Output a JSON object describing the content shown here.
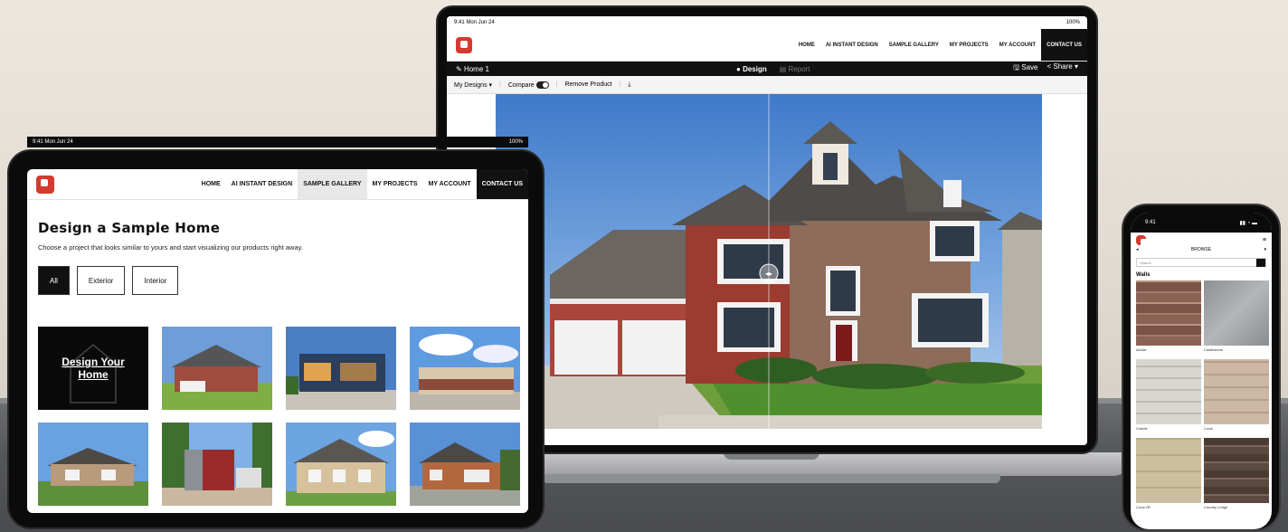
{
  "laptop": {
    "status_time": "9:41  Mon Jun 24",
    "status_right": "100%",
    "nav": [
      "HOME",
      "AI INSTANT DESIGN",
      "SAMPLE GALLERY",
      "MY PROJECTS",
      "MY ACCOUNT",
      "CONTACT US"
    ],
    "project_name": "Home 1",
    "tab_design": "Design",
    "tab_report": "Report",
    "save": "Save",
    "share": "Share",
    "tool_my_designs": "My Designs",
    "tool_compare": "Compare",
    "tool_remove": "Remove Product"
  },
  "tablet": {
    "status_time": "9:41  Mon Jun 24",
    "status_right": "100%",
    "nav": [
      "HOME",
      "AI INSTANT DESIGN",
      "SAMPLE GALLERY",
      "MY PROJECTS",
      "MY ACCOUNT",
      "CONTACT US"
    ],
    "title": "Design a Sample Home",
    "subtitle": "Choose a project that looks similar to yours and start visualizing our products right away.",
    "filters": [
      "All",
      "Exterior",
      "Interior"
    ],
    "design_tile": "Design Your Home"
  },
  "phone": {
    "status_time": "9:41",
    "browse": "BROWSE",
    "search_placeholder": "Search",
    "section": "Walls",
    "tiles": [
      "Ashlar",
      "Castlestone",
      "Cobble",
      "Coral",
      "Coral 2R",
      "Country Ledge"
    ]
  },
  "colors": {
    "brand": "#d43a2f",
    "dark": "#111111",
    "sky": "#3f79c9"
  }
}
